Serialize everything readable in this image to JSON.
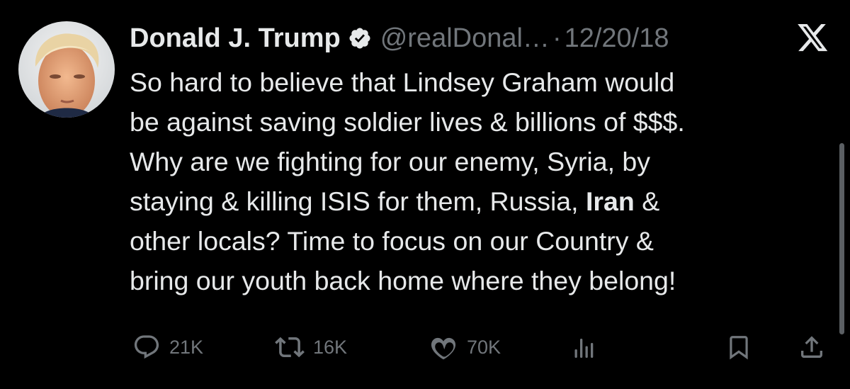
{
  "tweet": {
    "author": {
      "display_name": "Donald J. Trump",
      "verified_icon": "verified-badge-icon",
      "handle": "@realDonal…",
      "separator": "·",
      "date": "12/20/18"
    },
    "platform_logo": "x-logo-icon",
    "text_lines": [
      {
        "before": "So hard to believe that Lindsey Graham would",
        "bold": "",
        "after": ""
      },
      {
        "before": "be against saving soldier lives & billions of $$$.",
        "bold": "",
        "after": ""
      },
      {
        "before": "Why are we fighting for our enemy, Syria, by",
        "bold": "",
        "after": ""
      },
      {
        "before": "staying & killing ISIS for them, Russia, ",
        "bold": "Iran",
        "after": " &"
      },
      {
        "before": "other locals? Time to focus on our Country &",
        "bold": "",
        "after": ""
      },
      {
        "before": "bring our youth back home where they belong!",
        "bold": "",
        "after": ""
      }
    ],
    "actions": {
      "reply": {
        "icon": "reply-icon",
        "count": "21K"
      },
      "retweet": {
        "icon": "retweet-icon",
        "count": "16K"
      },
      "like": {
        "icon": "heart-icon",
        "count": "70K"
      },
      "views": {
        "icon": "views-icon",
        "count": ""
      },
      "bookmark": {
        "icon": "bookmark-icon"
      },
      "share": {
        "icon": "share-icon"
      }
    }
  },
  "colors": {
    "background": "#000000",
    "text_primary": "#e7e9ea",
    "text_secondary": "#71767b",
    "verified_blue": "#1d9bf0"
  }
}
